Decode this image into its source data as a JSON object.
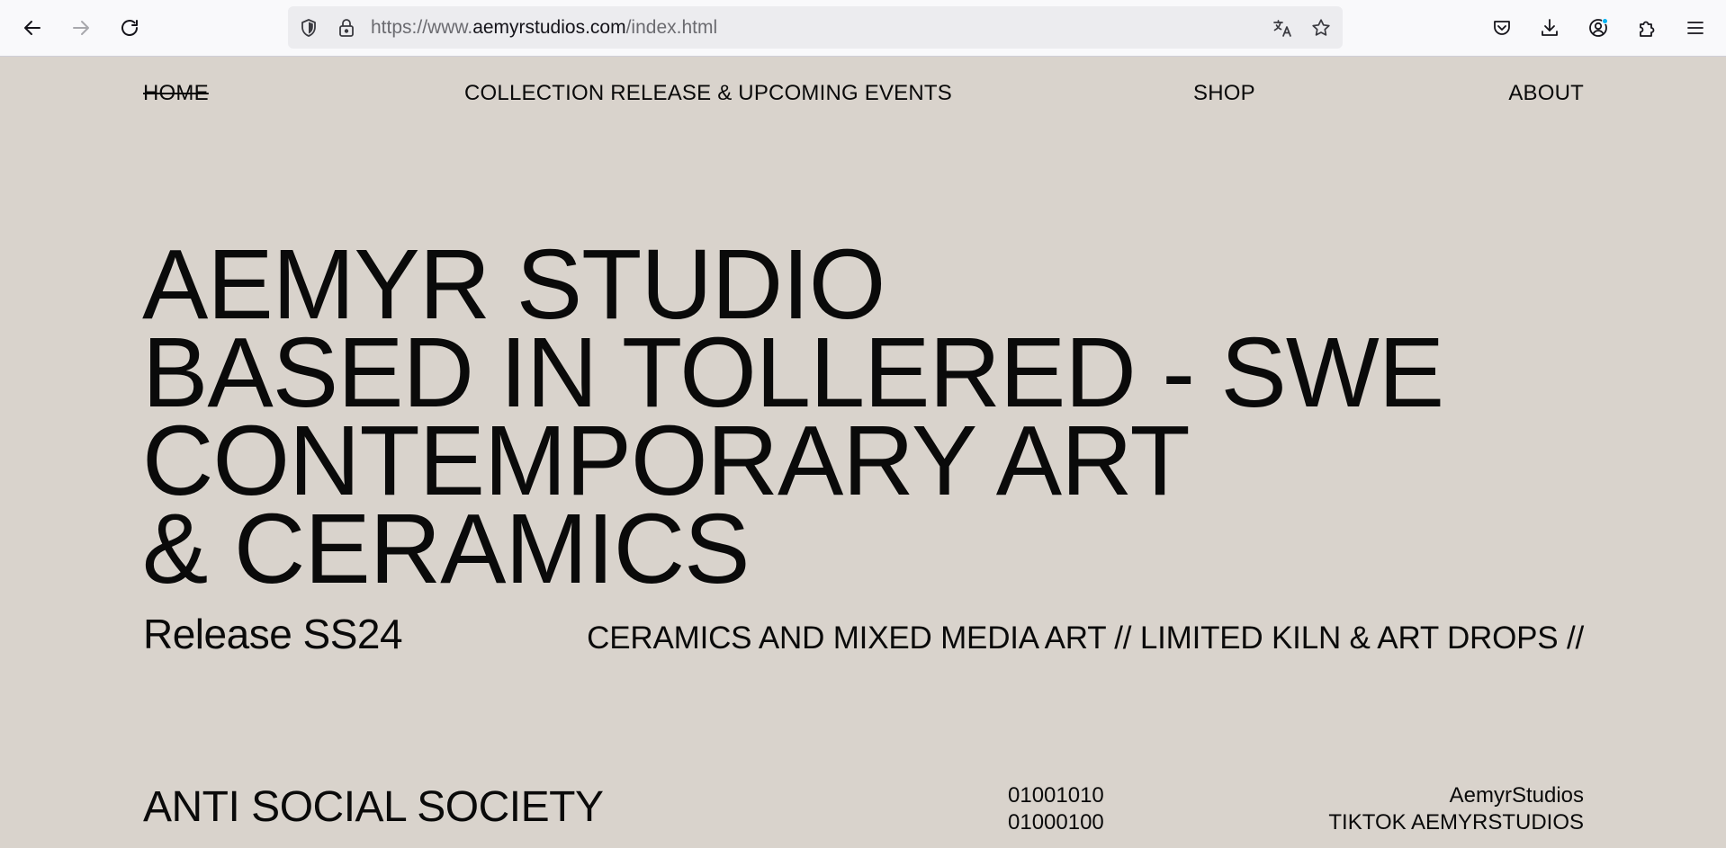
{
  "browser": {
    "url_prefix": "https://www.",
    "url_domain": "aemyrstudios.com",
    "url_path": "/index.html",
    "icons": {
      "back": "arrow-left-icon",
      "forward": "arrow-right-icon",
      "reload": "reload-icon",
      "shield": "tracking-shield-icon",
      "lock": "lock-icon",
      "translate": "translate-icon",
      "bookmark": "star-icon",
      "pocket": "pocket-icon",
      "downloads": "download-icon",
      "account": "account-icon",
      "extensions": "extensions-icon",
      "menu": "hamburger-menu-icon"
    },
    "accent_dot_color": "#00b3f4"
  },
  "nav": {
    "home": "HOME",
    "events": "COLLECTION RELEASE & UPCOMING EVENTS",
    "shop": "SHOP",
    "about": "ABOUT"
  },
  "hero": {
    "line1": "AEMYR STUDIO",
    "line2": "BASED IN TOLLERED - SWE",
    "line3": "CONTEMPORARY ART",
    "line4": "& CERAMICS"
  },
  "release": "Release SS24",
  "tagline": "CERAMICS AND MIXED MEDIA ART //  LIMITED KILN & ART DROPS //",
  "footer": {
    "society": "ANTI SOCIAL SOCIETY",
    "binary1": "01001010",
    "binary2": "01000100",
    "social1": "AemyrStudios",
    "social2": "TIKTOK AEMYRSTUDIOS"
  },
  "colors": {
    "page_background": "#d9d3cc",
    "text": "#0a0a0a"
  }
}
